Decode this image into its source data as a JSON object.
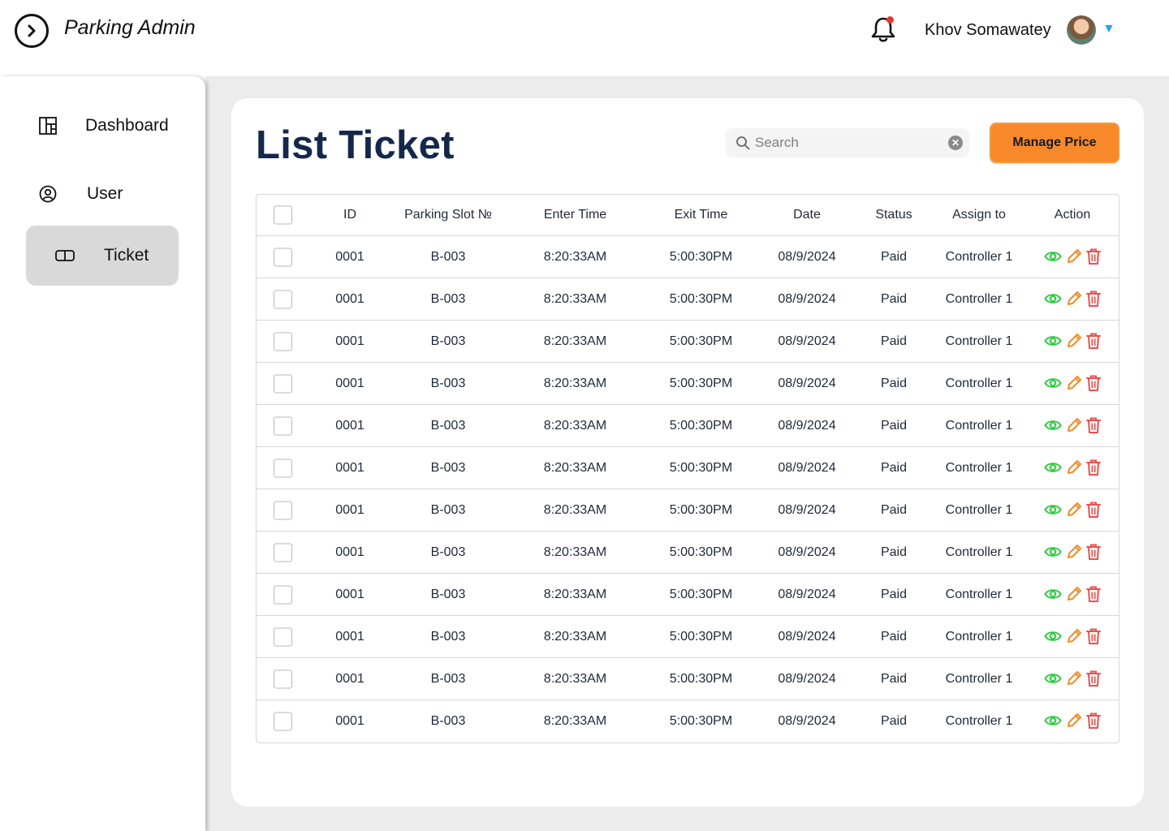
{
  "app": {
    "title": "Parking Admin",
    "notification_dot": true
  },
  "user": {
    "name": "Khov Somawatey"
  },
  "sidebar": {
    "items": [
      {
        "label": "Dashboard",
        "icon": "dashboard-icon",
        "active": false
      },
      {
        "label": "User",
        "icon": "user-icon",
        "active": false
      },
      {
        "label": "Ticket",
        "icon": "ticket-icon",
        "active": true
      }
    ]
  },
  "main": {
    "title": "List Ticket",
    "search": {
      "placeholder": "Search",
      "value": ""
    },
    "manage_button": "Manage Price",
    "colors": {
      "accent": "#f7892a",
      "title": "#14284b",
      "view": "#2ecc40",
      "edit": "#f08c2a",
      "delete": "#e8514f"
    }
  },
  "table": {
    "columns": [
      "ID",
      "Parking Slot №",
      "Enter Time",
      "Exit Time",
      "Date",
      "Status",
      "Assign to",
      "Action"
    ],
    "rows": [
      {
        "id": "0001",
        "slot": "B-003",
        "enter": "8:20:33AM",
        "exit": "5:00:30PM",
        "date": "08/9/2024",
        "status": "Paid",
        "assign": "Controller 1"
      },
      {
        "id": "0001",
        "slot": "B-003",
        "enter": "8:20:33AM",
        "exit": "5:00:30PM",
        "date": "08/9/2024",
        "status": "Paid",
        "assign": "Controller 1"
      },
      {
        "id": "0001",
        "slot": "B-003",
        "enter": "8:20:33AM",
        "exit": "5:00:30PM",
        "date": "08/9/2024",
        "status": "Paid",
        "assign": "Controller 1"
      },
      {
        "id": "0001",
        "slot": "B-003",
        "enter": "8:20:33AM",
        "exit": "5:00:30PM",
        "date": "08/9/2024",
        "status": "Paid",
        "assign": "Controller 1"
      },
      {
        "id": "0001",
        "slot": "B-003",
        "enter": "8:20:33AM",
        "exit": "5:00:30PM",
        "date": "08/9/2024",
        "status": "Paid",
        "assign": "Controller 1"
      },
      {
        "id": "0001",
        "slot": "B-003",
        "enter": "8:20:33AM",
        "exit": "5:00:30PM",
        "date": "08/9/2024",
        "status": "Paid",
        "assign": "Controller 1"
      },
      {
        "id": "0001",
        "slot": "B-003",
        "enter": "8:20:33AM",
        "exit": "5:00:30PM",
        "date": "08/9/2024",
        "status": "Paid",
        "assign": "Controller 1"
      },
      {
        "id": "0001",
        "slot": "B-003",
        "enter": "8:20:33AM",
        "exit": "5:00:30PM",
        "date": "08/9/2024",
        "status": "Paid",
        "assign": "Controller 1"
      },
      {
        "id": "0001",
        "slot": "B-003",
        "enter": "8:20:33AM",
        "exit": "5:00:30PM",
        "date": "08/9/2024",
        "status": "Paid",
        "assign": "Controller 1"
      },
      {
        "id": "0001",
        "slot": "B-003",
        "enter": "8:20:33AM",
        "exit": "5:00:30PM",
        "date": "08/9/2024",
        "status": "Paid",
        "assign": "Controller 1"
      },
      {
        "id": "0001",
        "slot": "B-003",
        "enter": "8:20:33AM",
        "exit": "5:00:30PM",
        "date": "08/9/2024",
        "status": "Paid",
        "assign": "Controller 1"
      },
      {
        "id": "0001",
        "slot": "B-003",
        "enter": "8:20:33AM",
        "exit": "5:00:30PM",
        "date": "08/9/2024",
        "status": "Paid",
        "assign": "Controller 1"
      }
    ]
  }
}
